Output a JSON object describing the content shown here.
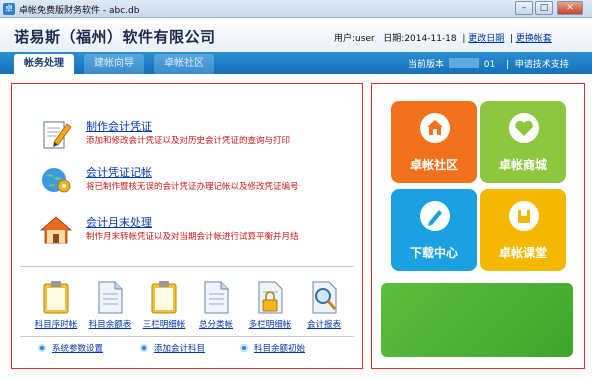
{
  "window": {
    "title": "卓帐免费版财务软件 - abc.db",
    "buttons": {
      "minimize": "–",
      "maximize": "□",
      "close": "✕"
    },
    "app_icon": "卓"
  },
  "header": {
    "company": "诺易斯（福州）软件有限公司",
    "user_label": "用户:",
    "user": "user",
    "date_label": "日期:",
    "date": "2014-11-18",
    "change_date": "更改日期",
    "change_account": "更换帐套"
  },
  "tabs": [
    {
      "label": "帐务处理",
      "active": true
    },
    {
      "label": "建帐向导",
      "active": false
    },
    {
      "label": "卓帐社区",
      "active": false
    }
  ],
  "tabbar": {
    "version_label": "当前版本",
    "version_suffix": "01",
    "support": "申请技术支持"
  },
  "tasks": [
    {
      "label": "制作会计凭证",
      "desc": "添加和修改会计凭证以及对历史会计凭证的查询与打印",
      "icon": "pencil-document-icon"
    },
    {
      "label": "会计凭证记帐",
      "desc": "将已制作暨核无误的会计凭证办理记帐以及修改凭证编号",
      "icon": "globe-gear-icon"
    },
    {
      "label": "会计月末处理",
      "desc": "制作月末转帐凭证以及对当期会计帐进行试算平衡并月结",
      "icon": "house-icon"
    }
  ],
  "quick_links": [
    {
      "label": "科目序时帐",
      "icon": "clipboard-icon"
    },
    {
      "label": "科目余额表",
      "icon": "document-icon"
    },
    {
      "label": "三栏明细帐",
      "icon": "clipboard-icon"
    },
    {
      "label": "总分类帐",
      "icon": "document-icon"
    },
    {
      "label": "多栏明细帐",
      "icon": "lock-document-icon"
    },
    {
      "label": "会计报表",
      "icon": "magnifier-icon"
    }
  ],
  "bottom_links": [
    {
      "label": "系统参数设置"
    },
    {
      "label": "添加会计科目"
    },
    {
      "label": "科目余额初始"
    }
  ],
  "tiles": [
    {
      "label": "卓帐社区",
      "color": "#f2711c",
      "icon": "home-icon"
    },
    {
      "label": "卓帐商城",
      "color": "#8dc63f",
      "icon": "heart-icon"
    },
    {
      "label": "下载中心",
      "color": "#1ba1e2",
      "icon": "pencil-icon"
    },
    {
      "label": "卓帐课堂",
      "color": "#f5b800",
      "icon": "book-icon"
    }
  ],
  "colors": {
    "tab_bar": "#1a78c2",
    "panel_border": "#e03030",
    "link": "#0038b0",
    "desc": "#d01818",
    "banner": "#4cae32"
  }
}
